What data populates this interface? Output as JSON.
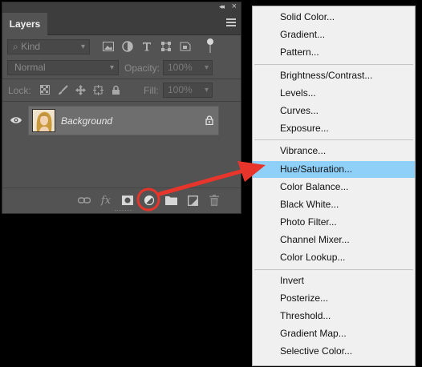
{
  "panel": {
    "tab_label": "Layers",
    "collapse_glyph": "◂◂",
    "close_glyph": "×",
    "filter": {
      "kind_label": "Kind",
      "icons": [
        "image-filter-icon",
        "adjustment-filter-icon",
        "type-filter-icon",
        "shape-filter-icon",
        "smart-object-filter-icon"
      ]
    },
    "blend_mode": "Normal",
    "opacity_label": "Opacity:",
    "opacity_value": "100%",
    "lock_label": "Lock:",
    "lock_icons": [
      "lock-transparent-icon",
      "lock-image-icon",
      "lock-position-icon",
      "prevent-auto-nesting-icon",
      "lock-all-icon"
    ],
    "fill_label": "Fill:",
    "fill_value": "100%",
    "layers": [
      {
        "name": "Background",
        "visible": true,
        "locked": true
      }
    ],
    "bottom_icons": [
      "link-layers-icon",
      "fx-icon",
      "add-mask-icon",
      "adjustment-layer-icon",
      "new-group-icon",
      "new-layer-icon",
      "trash-icon"
    ]
  },
  "menu": {
    "items": [
      {
        "label": "Solid Color...",
        "highlighted": false
      },
      {
        "label": "Gradient...",
        "highlighted": false
      },
      {
        "label": "Pattern...",
        "highlighted": false
      },
      {
        "label": "Brightness/Contrast...",
        "highlighted": false
      },
      {
        "label": "Levels...",
        "highlighted": false
      },
      {
        "label": "Curves...",
        "highlighted": false
      },
      {
        "label": "Exposure...",
        "highlighted": false
      },
      {
        "label": "Vibrance...",
        "highlighted": false
      },
      {
        "label": "Hue/Saturation...",
        "highlighted": true
      },
      {
        "label": "Color Balance...",
        "highlighted": false
      },
      {
        "label": "Black  White...",
        "highlighted": false
      },
      {
        "label": "Photo Filter...",
        "highlighted": false
      },
      {
        "label": "Channel Mixer...",
        "highlighted": false
      },
      {
        "label": "Color Lookup...",
        "highlighted": false
      },
      {
        "label": "Invert",
        "highlighted": false
      },
      {
        "label": "Posterize...",
        "highlighted": false
      },
      {
        "label": "Threshold...",
        "highlighted": false
      },
      {
        "label": "Gradient Map...",
        "highlighted": false
      },
      {
        "label": "Selective Color...",
        "highlighted": false
      }
    ]
  },
  "annotation": {
    "color": "#e8352b",
    "highlight_color": "#8fd0f9"
  }
}
